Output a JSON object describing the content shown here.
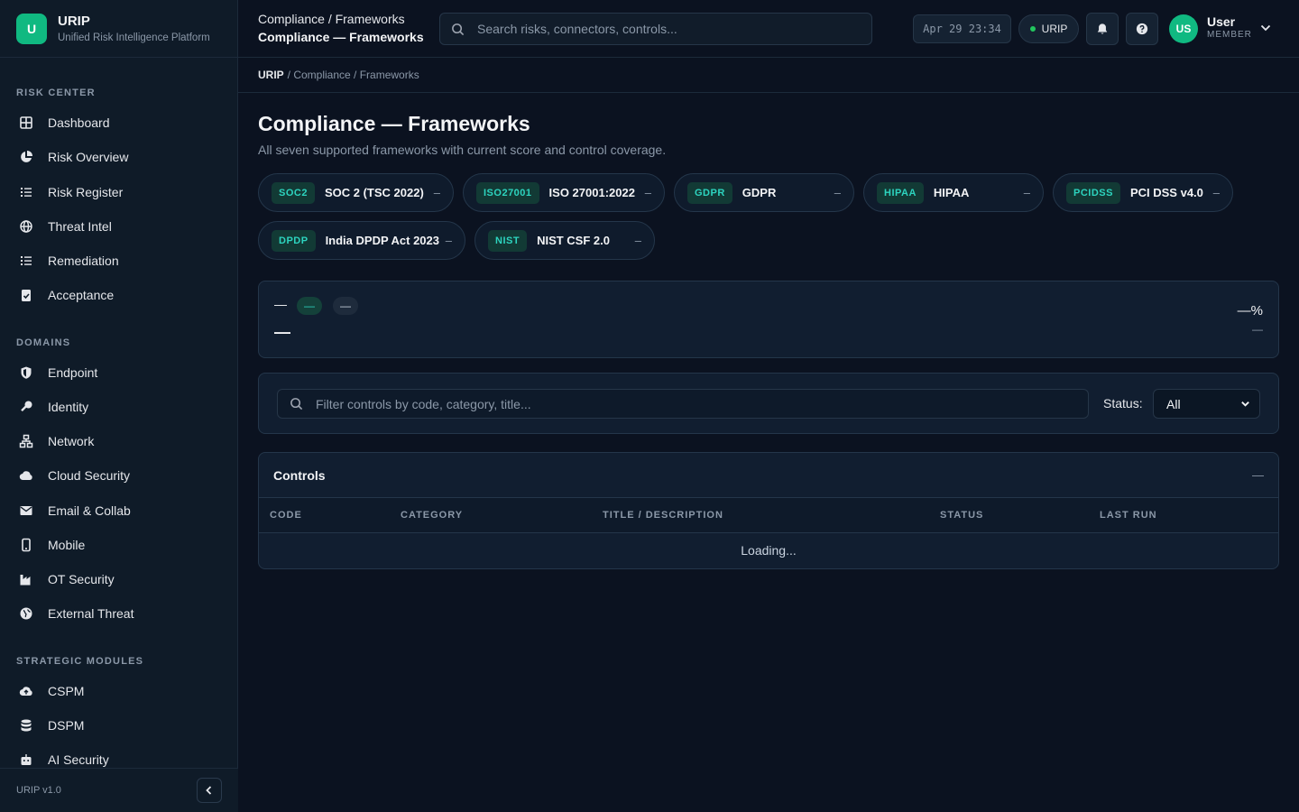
{
  "brand": {
    "logo_letter": "U",
    "name": "URIP",
    "subtitle": "Unified Risk Intelligence Platform"
  },
  "sidebar": {
    "sections": [
      {
        "title": "RISK CENTER"
      },
      {
        "title": "DOMAINS"
      },
      {
        "title": "STRATEGIC MODULES"
      }
    ],
    "items": [
      {
        "label": "Dashboard",
        "icon": "grid-icon"
      },
      {
        "label": "Risk Overview",
        "icon": "pie-chart-icon"
      },
      {
        "label": "Risk Register",
        "icon": "list-icon"
      },
      {
        "label": "Threat Intel",
        "icon": "globe-icon"
      },
      {
        "label": "Remediation",
        "icon": "checklist-icon"
      },
      {
        "label": "Acceptance",
        "icon": "clipboard-check-icon"
      },
      {
        "label": "Endpoint",
        "icon": "shield-icon"
      },
      {
        "label": "Identity",
        "icon": "key-icon"
      },
      {
        "label": "Network",
        "icon": "network-icon"
      },
      {
        "label": "Cloud Security",
        "icon": "cloud-icon"
      },
      {
        "label": "Email & Collab",
        "icon": "envelope-icon"
      },
      {
        "label": "Mobile",
        "icon": "mobile-icon"
      },
      {
        "label": "OT Security",
        "icon": "industry-icon"
      },
      {
        "label": "External Threat",
        "icon": "globe-alt-icon"
      },
      {
        "label": "CSPM",
        "icon": "cloud-upload-icon"
      },
      {
        "label": "DSPM",
        "icon": "database-icon"
      },
      {
        "label": "AI Security",
        "icon": "robot-icon"
      }
    ],
    "version": "URIP v1.0"
  },
  "topbar": {
    "breadcrumb": "Compliance / Frameworks",
    "page": "Compliance — Frameworks",
    "search_placeholder": "Search risks, connectors, controls...",
    "clock": "Apr 29 23:34",
    "tenant": "URIP",
    "user_initials": "US",
    "user_name": "User",
    "user_role": "MEMBER"
  },
  "crumb": {
    "root": "URIP",
    "rest": "/ Compliance / Frameworks"
  },
  "page": {
    "title": "Compliance — Frameworks",
    "subtitle": "All seven supported frameworks with current score and control coverage."
  },
  "frameworks": [
    {
      "code": "SOC2",
      "name": "SOC 2 (TSC 2022)",
      "score": "–"
    },
    {
      "code": "ISO27001",
      "name": "ISO 27001:2022",
      "score": "–"
    },
    {
      "code": "GDPR",
      "name": "GDPR",
      "score": "–"
    },
    {
      "code": "HIPAA",
      "name": "HIPAA",
      "score": "–"
    },
    {
      "code": "PCIDSS",
      "name": "PCI DSS v4.0",
      "score": "–"
    },
    {
      "code": "DPDP",
      "name": "India DPDP Act 2023",
      "score": "–"
    },
    {
      "code": "NIST",
      "name": "NIST CSF 2.0",
      "score": "–"
    }
  ],
  "score_panel": {
    "name": "—",
    "pill1": "—",
    "pill2": "—",
    "desc": "—",
    "percent": "—%",
    "pass": "—"
  },
  "filter": {
    "placeholder": "Filter controls by code, category, title...",
    "status_label": "Status:",
    "status_value": "All"
  },
  "controls": {
    "title": "Controls",
    "count": "—",
    "columns": [
      "CODE",
      "CATEGORY",
      "TITLE / DESCRIPTION",
      "STATUS",
      "LAST RUN"
    ],
    "loading": "Loading..."
  },
  "colors": {
    "accent": "#10b981",
    "teal": "#2dd4bf",
    "background": "#0b1220",
    "panel": "#111e30"
  }
}
